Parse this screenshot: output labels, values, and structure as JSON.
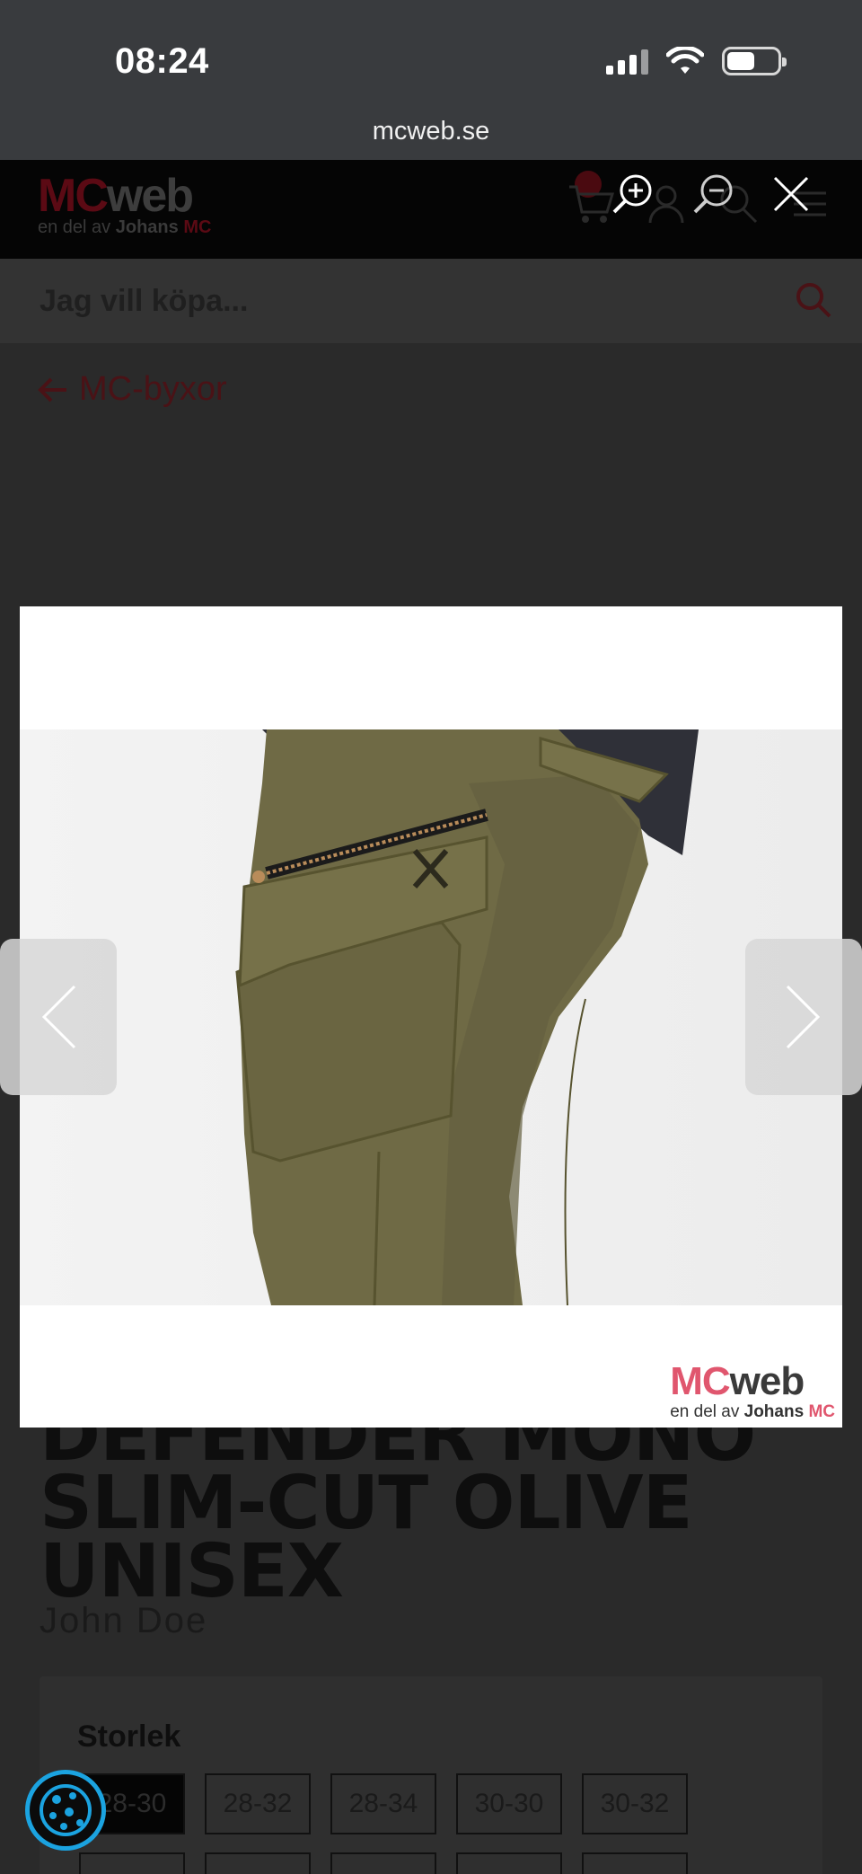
{
  "status_bar": {
    "time": "08:24",
    "url": "mcweb.se"
  },
  "site": {
    "logo": {
      "mc": "MC",
      "web": "web",
      "sub_prefix": "en del av",
      "sub_brand": "Johans",
      "sub_mc": "MC"
    },
    "search_placeholder": "Jag vill köpa...",
    "back_link": "MC-byxor"
  },
  "product": {
    "name_lines": [
      "DEFENDER MONO",
      "SLIM-CUT OLIVE",
      "UNISEX"
    ],
    "brand": "John Doe",
    "size_label": "Storlek",
    "sizes": [
      "28-30",
      "28-32",
      "28-34",
      "30-30",
      "30-32"
    ],
    "selected_size": "28-30"
  },
  "lightbox": {
    "watermark": {
      "mc": "MC",
      "web": "web",
      "sub_prefix": "en del av",
      "sub_brand": "Johans",
      "sub_mc": "MC"
    }
  },
  "colors": {
    "brand_red": "#e0566e",
    "olive": "#6f6a45",
    "cookie_blue": "#1ba3e0"
  }
}
